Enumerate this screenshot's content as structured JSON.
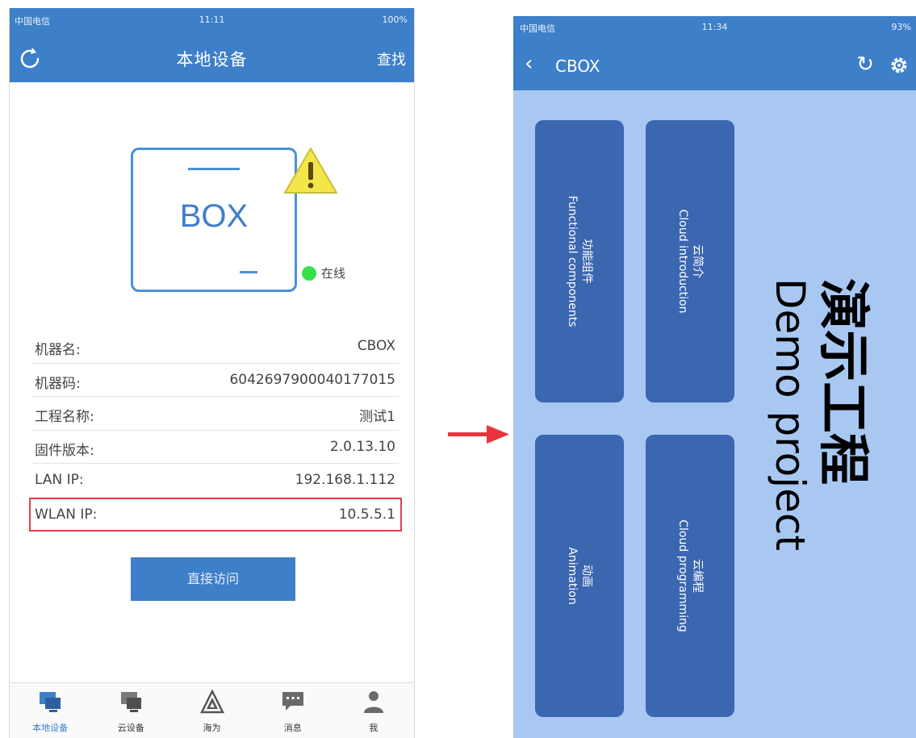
{
  "left": {
    "status": {
      "carrier": "中国电信",
      "time": "11:11",
      "battery": "100%"
    },
    "nav": {
      "title": "本地设备",
      "search_label": "查找"
    },
    "device": {
      "box_label": "BOX",
      "status_text": "在线",
      "status_color": "#38e04a"
    },
    "info": [
      {
        "key": "机器名:",
        "value": "CBOX"
      },
      {
        "key": "机器码:",
        "value": "6042697900040177015"
      },
      {
        "key": "工程名称:",
        "value": "测试1"
      },
      {
        "key": "固件版本:",
        "value": "2.0.13.10"
      },
      {
        "key": "LAN IP:",
        "value": "192.168.1.112"
      },
      {
        "key": "WLAN IP:",
        "value": "10.5.5.1"
      }
    ],
    "direct_button": "直接访问",
    "tabs": [
      {
        "label": "本地设备",
        "icon": "monitor-icon",
        "active": true
      },
      {
        "label": "云设备",
        "icon": "cloud-device-icon",
        "active": false
      },
      {
        "label": "海为",
        "icon": "haiwell-logo-icon",
        "active": false
      },
      {
        "label": "消息",
        "icon": "message-icon",
        "active": false
      },
      {
        "label": "我",
        "icon": "person-icon",
        "active": false
      }
    ]
  },
  "right": {
    "status": {
      "carrier": "中国电信",
      "time": "11:34",
      "battery": "93%"
    },
    "nav": {
      "title": "CBOX"
    },
    "tiles": [
      {
        "cn": "功能组件",
        "en": "Functional components"
      },
      {
        "cn": "云简介",
        "en": "Cloud introduction"
      },
      {
        "cn": "动画",
        "en": "Animation"
      },
      {
        "cn": "云编程",
        "en": "Cloud programming"
      }
    ],
    "demo": {
      "cn": "演示工程",
      "en": "Demo project"
    }
  },
  "colors": {
    "primary": "#3d7fc9",
    "tile": "#3b66b0",
    "panel": "#a8c8f2",
    "highlight": "#e0424b",
    "arrow": "#e8343c"
  }
}
